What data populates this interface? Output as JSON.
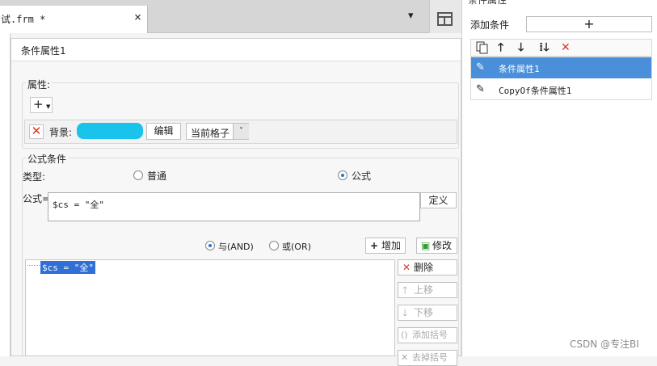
{
  "editor": {
    "tab_label": "试.frm *",
    "tab_close": "×",
    "tab_menu": "▾"
  },
  "panel": {
    "title": "条件属性",
    "add_condition_label": "添加条件",
    "add_condition_button": "+",
    "toolbar_icons": [
      "copy-icon",
      "arrow-up-icon",
      "arrow-down-icon",
      "move-bottom-icon",
      "delete-icon"
    ],
    "conditions": [
      {
        "label": "条件属性1",
        "selected": true
      },
      {
        "label": "CopyOf条件属性1",
        "selected": false
      }
    ]
  },
  "dialog": {
    "title": "条件属性1",
    "attributes_label": "属性:",
    "add_attr_button": "+",
    "background_label": "背景:",
    "background_color": "#19c3ec",
    "edit_button": "编辑",
    "scope_select_value": "当前格子",
    "formula_group_label": "公式条件",
    "type_label": "类型:",
    "type_normal": "普通",
    "type_formula": "公式",
    "type_selected": "公式",
    "formula_label": "公式=",
    "formula_value": "$cs = \"全\"",
    "define_button": "定义",
    "logic_and": "与(AND)",
    "logic_or": "或(OR)",
    "logic_selected": "与(AND)",
    "add_button": "增加",
    "modify_button": "修改",
    "conditions_tree": [
      "$cs = \"全\""
    ],
    "delete_button": "删除",
    "move_up_button": "上移",
    "move_down_button": "下移",
    "add_bracket_button": "添加括号",
    "remove_bracket_button": "去掉括号"
  },
  "colors": {
    "accent": "#4a8fd9",
    "selection": "#2f6fd6",
    "delete_red": "#dd3322"
  },
  "watermark": "CSDN @专注BI"
}
